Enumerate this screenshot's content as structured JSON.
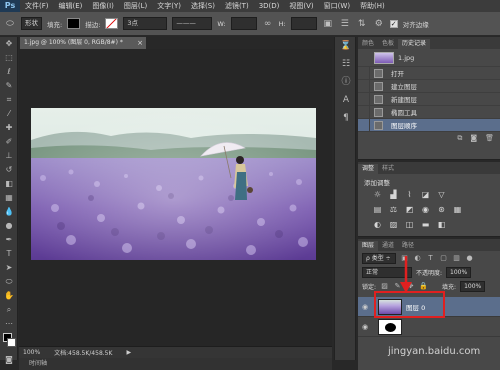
{
  "menubar": {
    "logo": "Ps",
    "items": [
      "文件(F)",
      "编辑(E)",
      "图像(I)",
      "图层(L)",
      "文字(Y)",
      "选择(S)",
      "滤镜(T)",
      "3D(D)",
      "视图(V)",
      "窗口(W)",
      "帮助(H)"
    ]
  },
  "options": {
    "shape_mode": "形状",
    "fill_label": "填充:",
    "stroke_label": "描边:",
    "stroke_size": "3点",
    "w_label": "W:",
    "h_label": "H:",
    "align_edges_label": "对齐边缘",
    "fill_color": "#000000"
  },
  "document": {
    "tab_title": "1.jpg @ 100% (图层 0, RGB/8#) *",
    "zoom": "100%",
    "doc_size": "文档:458.5K/458.5K"
  },
  "timeline": {
    "label": "时间轴"
  },
  "history_panel": {
    "tabs": [
      "颜色",
      "色板",
      "历史记录"
    ],
    "snapshot": "1.jpg",
    "items": [
      "打开",
      "建立图层",
      "新建图层",
      "椭圆工具",
      "图层顺序"
    ]
  },
  "adjust_panel": {
    "tabs": [
      "调整",
      "样式"
    ],
    "title": "添加调整"
  },
  "layers_panel": {
    "tabs": [
      "图层",
      "通道",
      "路径"
    ],
    "kind_label": "类型",
    "blend_mode": "正常",
    "opacity_label": "不透明度:",
    "opacity": "100%",
    "lock_label": "锁定:",
    "fill_label": "填充:",
    "fill": "100%",
    "layers": [
      {
        "name": "图层 0",
        "selected": true
      },
      {
        "name": "",
        "selected": false
      }
    ]
  },
  "watermark": "jingyan.baidu.com",
  "colors": {
    "selection": "#5b6e8c",
    "annotation": "#e02020",
    "panel_bg": "#484848"
  }
}
